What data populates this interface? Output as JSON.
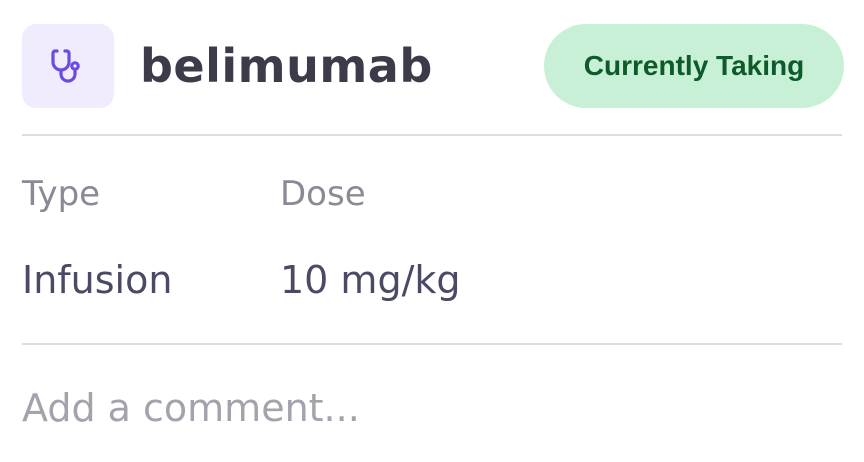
{
  "medication": {
    "icon": "stethoscope-icon",
    "name": "belimumab",
    "status": "Currently Taking"
  },
  "details": {
    "type_label": "Type",
    "type_value": "Infusion",
    "dose_label": "Dose",
    "dose_value": "10 mg/kg"
  },
  "comment": {
    "placeholder": "Add a comment...",
    "value": ""
  },
  "colors": {
    "accent": "#6b4be0",
    "icon_bg": "#f1ecfd",
    "status_bg": "#c8f0d6",
    "status_text": "#0f5a2b"
  }
}
